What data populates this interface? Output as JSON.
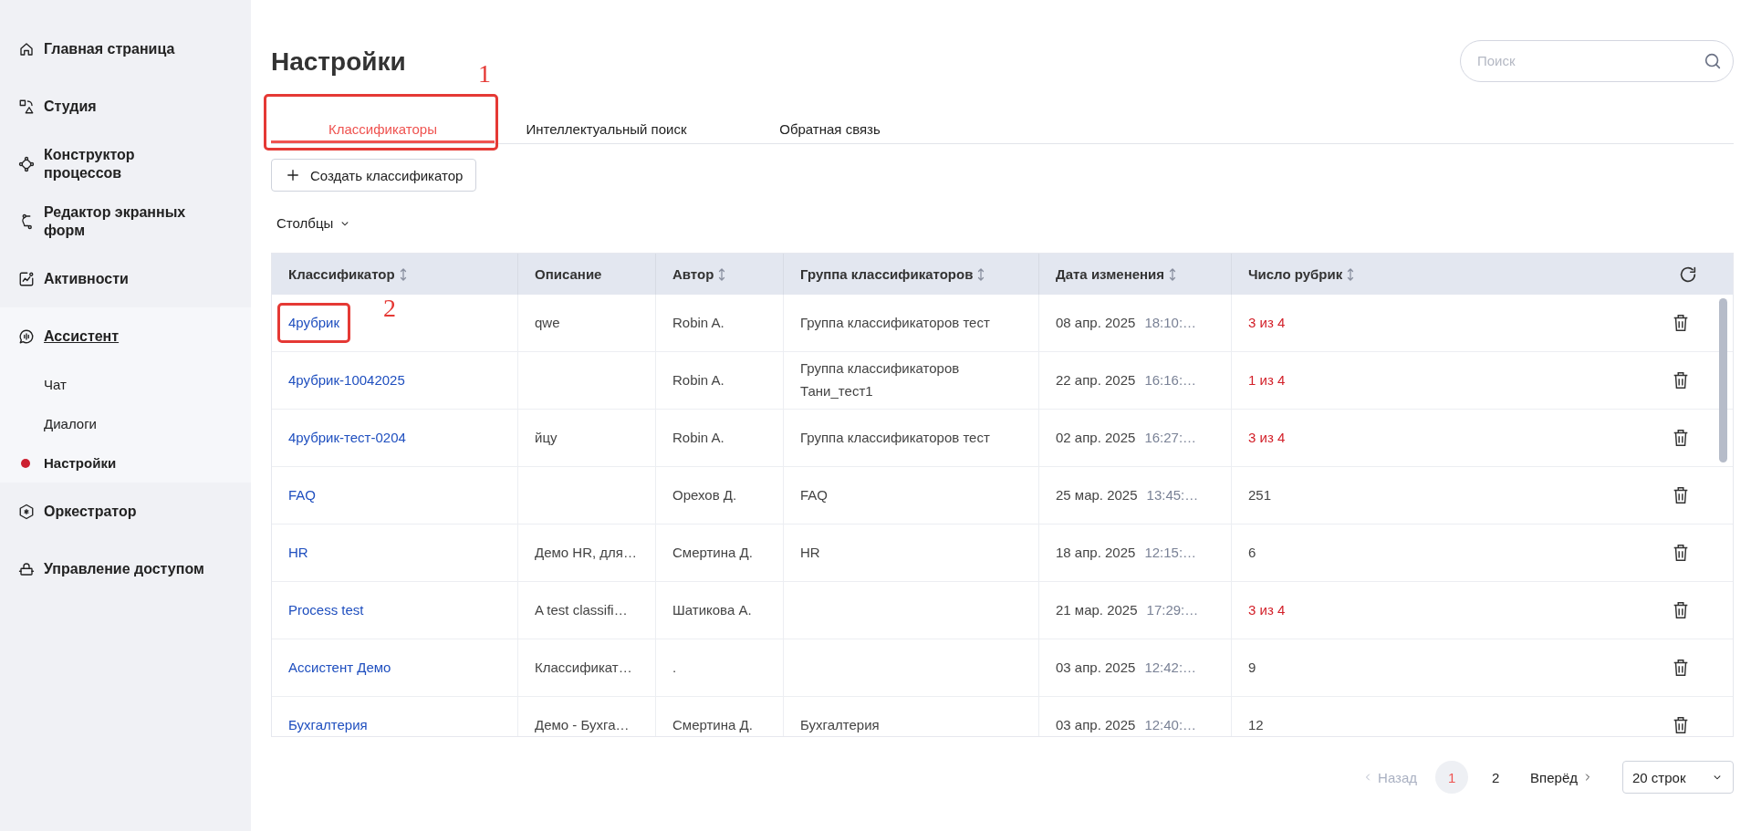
{
  "sidebar": {
    "items": [
      {
        "label": "Главная страница",
        "expanded": false
      },
      {
        "label": "Студия",
        "expanded": false
      },
      {
        "label": "Конструктор процессов",
        "expanded": false
      },
      {
        "label": "Редактор экранных форм",
        "expanded": false
      },
      {
        "label": "Активности",
        "expanded": false
      },
      {
        "label": "Ассистент",
        "expanded": true,
        "children": [
          {
            "label": "Чат",
            "selected": false
          },
          {
            "label": "Диалоги",
            "selected": false
          },
          {
            "label": "Настройки",
            "selected": true
          }
        ]
      },
      {
        "label": "Оркестратор",
        "expanded": false
      },
      {
        "label": "Управление доступом",
        "expanded": false
      }
    ]
  },
  "page": {
    "title": "Настройки",
    "search": {
      "placeholder": "Поиск"
    }
  },
  "tabs": [
    {
      "label": "Классификаторы",
      "selected": true,
      "callout": "1"
    },
    {
      "label": "Интеллектуальный поиск",
      "selected": false
    },
    {
      "label": "Обратная связь",
      "selected": false
    }
  ],
  "create_button": "Создать классификатор",
  "columns_toggle": "Столбцы",
  "table": {
    "columns": [
      {
        "label": "Классификатор",
        "sortable": true
      },
      {
        "label": "Описание",
        "sortable": false
      },
      {
        "label": "Автор",
        "sortable": true
      },
      {
        "label": "Группа классификаторов",
        "sortable": true
      },
      {
        "label": "Дата изменения",
        "sortable": true
      },
      {
        "label": "Число рубрик",
        "sortable": true
      }
    ],
    "rows": [
      {
        "name": "4рубрик",
        "callout": "2",
        "description": "qwe",
        "author": "Robin A.",
        "group": "Группа классификаторов тест",
        "date": "08 апр. 2025",
        "time": "18:10:…",
        "rubrics": "3 из 4",
        "partial": true
      },
      {
        "name": "4рубрик-10042025",
        "author": "Robin A.",
        "group": "Группа классификаторов Тани_тест1",
        "date": "22 апр. 2025",
        "time": "16:16:…",
        "rubrics": "1 из 4",
        "partial": true
      },
      {
        "name": "4рубрик-тест-0204",
        "description": "йцу",
        "author": "Robin A.",
        "group": "Группа классификаторов тест",
        "date": "02 апр. 2025",
        "time": "16:27:…",
        "rubrics": "3 из 4",
        "partial": true
      },
      {
        "name": "FAQ",
        "author": "Орехов Д.",
        "group": "FAQ",
        "date": "25 мар. 2025",
        "time": "13:45:…",
        "rubrics": "251",
        "partial": false
      },
      {
        "name": "HR",
        "description": "Демо HR, для…",
        "author": "Смертина Д.",
        "group": "HR",
        "date": "18 апр. 2025",
        "time": "12:15:…",
        "rubrics": "6",
        "partial": false
      },
      {
        "name": "Process test",
        "description": "A test classifi…",
        "author": "Шатикова А.",
        "date": "21 мар. 2025",
        "time": "17:29:…",
        "rubrics": "3 из 4",
        "partial": true
      },
      {
        "name": "Ассистент Демо",
        "description": "Классификат…",
        "author": ".",
        "date": "03 апр. 2025",
        "time": "12:42:…",
        "rubrics": "9",
        "partial": false
      },
      {
        "name": "Бухгалтерия",
        "description": "Демо - Бухга…",
        "author": "Смертина Д.",
        "group": "Бухгалтерия",
        "date": "03 апр. 2025",
        "time": "12:40:…",
        "rubrics": "12",
        "partial": false
      }
    ]
  },
  "pagination": {
    "prev": {
      "label": "Назад",
      "disabled": true
    },
    "pages": [
      {
        "label": "1",
        "selected": true
      },
      {
        "label": "2",
        "selected": false
      }
    ],
    "next": {
      "label": "Вперёд",
      "disabled": false
    },
    "page_size": "20 строк"
  }
}
